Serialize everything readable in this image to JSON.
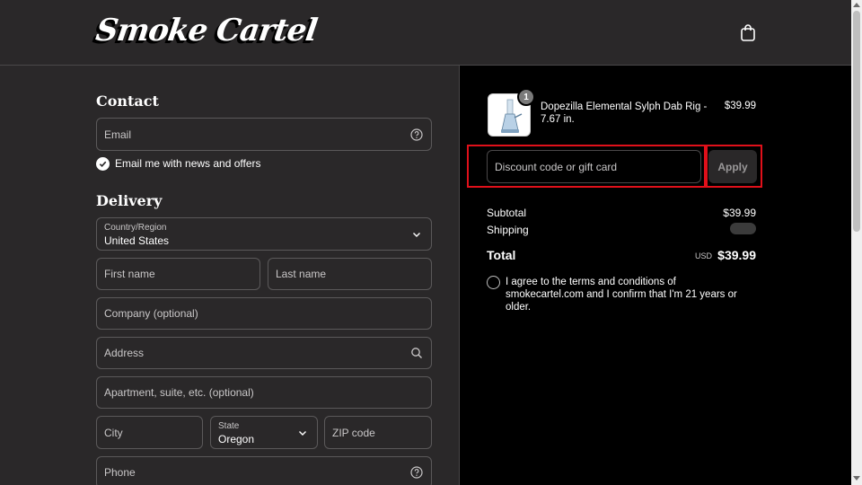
{
  "header": {
    "logo_text": "Smoke Cartel",
    "cart_icon": "shopping-bag-icon"
  },
  "contact": {
    "title": "Contact",
    "email_placeholder": "Email",
    "newsletter_label": "Email me with news and offers",
    "newsletter_checked": true
  },
  "delivery": {
    "title": "Delivery",
    "country_label": "Country/Region",
    "country_value": "United States",
    "first_name_placeholder": "First name",
    "last_name_placeholder": "Last name",
    "company_placeholder": "Company (optional)",
    "address_placeholder": "Address",
    "apartment_placeholder": "Apartment, suite, etc. (optional)",
    "city_placeholder": "City",
    "state_label": "State",
    "state_value": "Oregon",
    "zip_placeholder": "ZIP code",
    "phone_placeholder": "Phone"
  },
  "order": {
    "item": {
      "name": "Dopezilla Elemental Sylph Dab Rig - 7.67 in.",
      "price": "$39.99",
      "quantity": "1"
    },
    "discount_placeholder": "Discount code or gift card",
    "apply_label": "Apply",
    "subtotal_label": "Subtotal",
    "subtotal_value": "$39.99",
    "shipping_label": "Shipping",
    "total_label": "Total",
    "total_currency": "USD",
    "total_value": "$39.99",
    "agree_text": "I agree to the terms and conditions of smokecartel.com and I confirm that I'm 21 years or older."
  },
  "colors": {
    "highlight": "#e0101a",
    "left_bg": "#2a2829",
    "right_bg": "#000000"
  }
}
